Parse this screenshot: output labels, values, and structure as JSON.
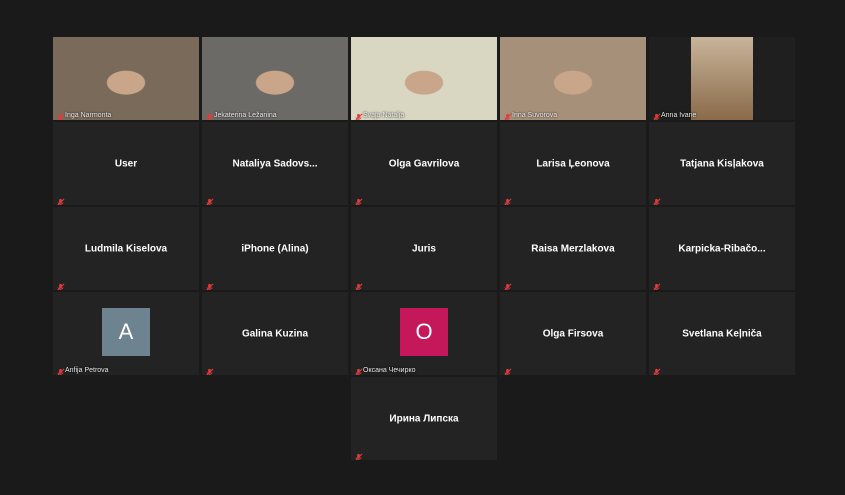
{
  "participants": [
    {
      "name": "Inga Narmonta",
      "video": true,
      "bg": "#7a6a5a"
    },
    {
      "name": "Jekaterina Ležanina",
      "video": true,
      "bg": "#6c6a66"
    },
    {
      "name": "Svaja Natalja",
      "video": true,
      "bg": "#d9d6c2",
      "active": true
    },
    {
      "name": "Irina Suvorova",
      "video": true,
      "bg": "#a6907a"
    },
    {
      "name": "Anna Ivane",
      "video": true,
      "bg": "#2a2a2a"
    },
    {
      "name": "User"
    },
    {
      "name": "Nataliya  Sadovs..."
    },
    {
      "name": "Olga Gavrilova"
    },
    {
      "name": "Larisa Ļeonova"
    },
    {
      "name": "Tatjana Kisļakova"
    },
    {
      "name": "Ludmila Kiselova"
    },
    {
      "name": "iPhone (Alina)"
    },
    {
      "name": "Juris"
    },
    {
      "name": "Raisa Merzlakova"
    },
    {
      "name": "Karpicka-Ribačo..."
    },
    {
      "name": "Anfija Petrova",
      "avatar": "A",
      "avatar_color": "#6e8390"
    },
    {
      "name": "Galina Kuzina"
    },
    {
      "name": "Оксана Чечирко",
      "avatar": "O",
      "avatar_color": "#c4185a"
    },
    {
      "name": "Olga Firsova"
    },
    {
      "name": "Svetlana Keļniča"
    },
    {
      "name": "Ирина Липска"
    }
  ],
  "colors": {
    "mic_muted": "#e03c3c",
    "active_border": "#c9e23a"
  },
  "icons": {
    "mic": "mic-muted-icon"
  }
}
